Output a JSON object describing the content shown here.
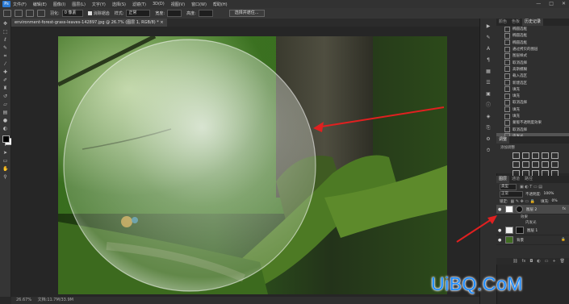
{
  "menubar": {
    "logo": "Ps",
    "items": [
      "文件(F)",
      "编辑(E)",
      "图像(I)",
      "图层(L)",
      "文字(Y)",
      "选择(S)",
      "滤镜(T)",
      "3D(D)",
      "视图(V)",
      "窗口(W)",
      "帮助(H)"
    ],
    "window_controls": [
      "—",
      "□",
      "✕"
    ]
  },
  "options": {
    "feather_label": "羽化:",
    "feather_value": "0 像素",
    "antialias_label": "消除锯齿",
    "style_label": "样式:",
    "style_value": "正常",
    "width_label": "宽度:",
    "height_label": "高度:",
    "select_mask_button": "选择并遮住..."
  },
  "document": {
    "tab_title": "environment-forest-grass-leaves-142897.jpg @ 26.7% (图层 1, RGB/8) *",
    "status_zoom": "26.67%",
    "status_doc": "文档:11.7M/33.9M"
  },
  "tools": [
    "move-tool",
    "marquee-tool",
    "lasso-tool",
    "quick-select-tool",
    "crop-tool",
    "eyedropper-tool",
    "healing-tool",
    "brush-tool",
    "stamp-tool",
    "history-brush-tool",
    "eraser-tool",
    "gradient-tool",
    "blur-tool",
    "dodge-tool",
    "pen-tool",
    "type-tool",
    "path-select-tool",
    "shape-tool",
    "hand-tool",
    "zoom-tool"
  ],
  "history": {
    "tabs": [
      "颜色",
      "色板",
      "历史记录"
    ],
    "active_tab": "历史记录",
    "items": [
      "椭圆选框",
      "椭圆选框",
      "椭圆选框",
      "通过拷贝的图层",
      "图层样式",
      "取消选择",
      "高斯模糊",
      "载入选区",
      "新建选区",
      "填充",
      "填充",
      "取消选择",
      "填充",
      "填充",
      "蒙版不透明度效果",
      "取消选择",
      "内发光"
    ]
  },
  "adjustments": {
    "title": "调整",
    "add_label": "添加调整"
  },
  "layers": {
    "tabs": [
      "图层",
      "通道",
      "路径"
    ],
    "kind_filter": "类型",
    "blend_mode": "正常",
    "opacity_label": "不透明度:",
    "opacity_value": "100%",
    "lock_label": "锁定:",
    "fill_label": "填充:",
    "fill_value": "0%",
    "rows": [
      {
        "name": "图层 2",
        "fx": "fx"
      },
      {
        "name": "图层 1",
        "fx": ""
      },
      {
        "name": "背景",
        "fx": ""
      }
    ],
    "effects_label": "效果",
    "effect_name": "内发光"
  },
  "watermark": "UiBQ.CoM",
  "colors": {
    "canvas_bg": "#262626",
    "panel_bg": "#2f2f2f",
    "annotation_arrow": "#e02020",
    "watermark_color": "#1e8cff"
  }
}
